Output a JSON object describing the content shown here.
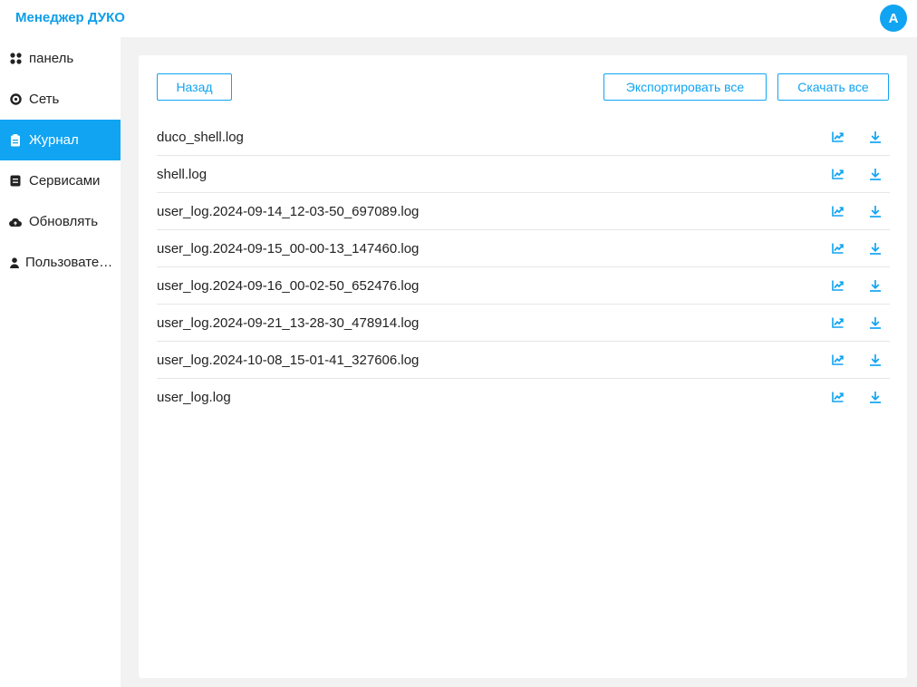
{
  "header": {
    "app_title": "Менеджер ДУКО",
    "avatar_letter": "A"
  },
  "sidebar": {
    "items": [
      {
        "label": "панель",
        "icon": "grid-icon"
      },
      {
        "label": "Сеть",
        "icon": "network-icon"
      },
      {
        "label": "Журнал",
        "icon": "clipboard-icon",
        "active": true
      },
      {
        "label": "Сервисами",
        "icon": "service-icon"
      },
      {
        "label": "Обновлять",
        "icon": "cloud-icon"
      },
      {
        "label": "Пользовате…",
        "icon": "user-icon"
      }
    ]
  },
  "toolbar": {
    "back_label": "Назад",
    "export_all_label": "Экспортировать все",
    "download_all_label": "Скачать все"
  },
  "files": [
    "duco_shell.log",
    "shell.log",
    "user_log.2024-09-14_12-03-50_697089.log",
    "user_log.2024-09-15_00-00-13_147460.log",
    "user_log.2024-09-16_00-02-50_652476.log",
    "user_log.2024-09-21_13-28-30_478914.log",
    "user_log.2024-10-08_15-01-41_327606.log",
    "user_log.log"
  ],
  "colors": {
    "accent": "#10a4f2",
    "title": "#0e9ee8",
    "background": "#f2f2f2"
  }
}
